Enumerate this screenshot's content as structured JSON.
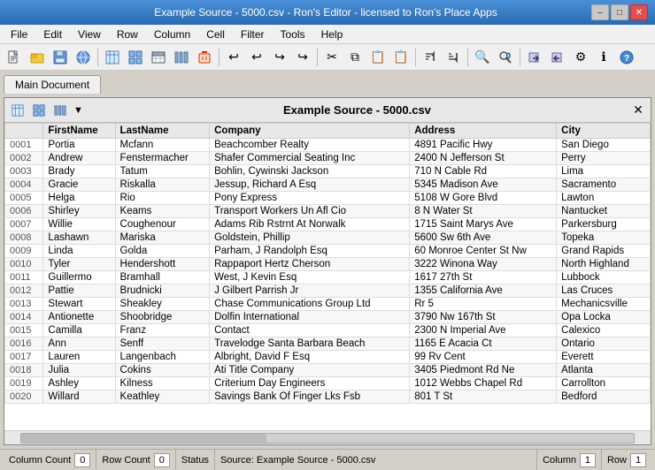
{
  "titleBar": {
    "title": "Example Source - 5000.csv - Ron's Editor - licensed to Ron's Place Apps",
    "minBtn": "–",
    "maxBtn": "□",
    "closeBtn": "✕"
  },
  "menuBar": {
    "items": [
      "File",
      "Edit",
      "View",
      "Row",
      "Column",
      "Cell",
      "Filter",
      "Tools",
      "Help"
    ]
  },
  "tab": {
    "label": "Main Document"
  },
  "innerDoc": {
    "title": "Example Source - 5000.csv"
  },
  "table": {
    "columns": [
      "FirstName",
      "LastName",
      "Company",
      "Address",
      "City"
    ],
    "rows": [
      {
        "num": "0001",
        "first": "Portia",
        "last": "Mcfann",
        "company": "Beachcomber Realty",
        "address": "4891 Pacific Hwy",
        "city": "San Diego"
      },
      {
        "num": "0002",
        "first": "Andrew",
        "last": "Fenstermacher",
        "company": "Shafer Commercial Seating Inc",
        "address": "2400 N Jefferson St",
        "city": "Perry"
      },
      {
        "num": "0003",
        "first": "Brady",
        "last": "Tatum",
        "company": "Bohlin, Cywinski Jackson",
        "address": "710 N Cable Rd",
        "city": "Lima"
      },
      {
        "num": "0004",
        "first": "Gracie",
        "last": "Riskalla",
        "company": "Jessup, Richard A Esq",
        "address": "5345 Madison Ave",
        "city": "Sacramento"
      },
      {
        "num": "0005",
        "first": "Helga",
        "last": "Rio",
        "company": "Pony Express",
        "address": "5108 W Gore Blvd",
        "city": "Lawton"
      },
      {
        "num": "0006",
        "first": "Shirley",
        "last": "Keams",
        "company": "Transport Workers Un Afl Cio",
        "address": "8 N Water St",
        "city": "Nantucket"
      },
      {
        "num": "0007",
        "first": "Willie",
        "last": "Coughenour",
        "company": "Adams Rib Rstrnt At Norwalk",
        "address": "1715 Saint Marys Ave",
        "city": "Parkersburg"
      },
      {
        "num": "0008",
        "first": "Lashawn",
        "last": "Mariska",
        "company": "Goldstein, Phillip",
        "address": "5600 Sw 6th Ave",
        "city": "Topeka"
      },
      {
        "num": "0009",
        "first": "Linda",
        "last": "Golda",
        "company": "Parham, J Randolph Esq",
        "address": "60 Monroe Center St Nw",
        "city": "Grand Rapids"
      },
      {
        "num": "0010",
        "first": "Tyler",
        "last": "Hendershott",
        "company": "Rappaport Hertz Cherson",
        "address": "3222 Winona Way",
        "city": "North Highland"
      },
      {
        "num": "0011",
        "first": "Guillermo",
        "last": "Bramhall",
        "company": "West, J Kevin Esq",
        "address": "1617 27th St",
        "city": "Lubbock"
      },
      {
        "num": "0012",
        "first": "Pattie",
        "last": "Brudnicki",
        "company": "J Gilbert Parrish Jr",
        "address": "1355 California Ave",
        "city": "Las Cruces"
      },
      {
        "num": "0013",
        "first": "Stewart",
        "last": "Sheakley",
        "company": "Chase Communications Group Ltd",
        "address": "Rr 5",
        "city": "Mechanicsville"
      },
      {
        "num": "0014",
        "first": "Antionette",
        "last": "Shoobridge",
        "company": "Dolfin International",
        "address": "3790 Nw 167th St",
        "city": "Opa Locka"
      },
      {
        "num": "0015",
        "first": "Camilla",
        "last": "Franz",
        "company": "Contact",
        "address": "2300 N Imperial Ave",
        "city": "Calexico"
      },
      {
        "num": "0016",
        "first": "Ann",
        "last": "Senff",
        "company": "Travelodge Santa Barbara Beach",
        "address": "1165 E Acacia Ct",
        "city": "Ontario"
      },
      {
        "num": "0017",
        "first": "Lauren",
        "last": "Langenbach",
        "company": "Albright, David F Esq",
        "address": "99 Rv Cent",
        "city": "Everett"
      },
      {
        "num": "0018",
        "first": "Julia",
        "last": "Cokins",
        "company": "Ati Title Company",
        "address": "3405 Piedmont Rd Ne",
        "city": "Atlanta"
      },
      {
        "num": "0019",
        "first": "Ashley",
        "last": "Kilness",
        "company": "Criterium Day Engineers",
        "address": "1012 Webbs Chapel Rd",
        "city": "Carrollton"
      },
      {
        "num": "0020",
        "first": "Willard",
        "last": "Keathley",
        "company": "Savings Bank Of Finger Lks Fsb",
        "address": "801 T St",
        "city": "Bedford"
      }
    ]
  },
  "statusBar": {
    "columnCountLabel": "Column Count",
    "columnCountVal": "0",
    "rowCountLabel": "Row Count",
    "rowCountVal": "0",
    "statusLabel": "Status",
    "sourceText": "Source: Example Source - 5000.csv",
    "columnLabel": "Column",
    "columnVal": "1",
    "rowLabel": "Row",
    "rowVal": "1"
  },
  "icons": {
    "new": "📄",
    "open": "📂",
    "save": "💾",
    "globe": "🌐",
    "tableIcon": "⊞",
    "undo": "↩",
    "redo": "↪",
    "cut": "✂",
    "copy": "⧉",
    "paste": "📋",
    "find": "🔍",
    "arrow": "→",
    "info": "ℹ",
    "close": "✕"
  }
}
